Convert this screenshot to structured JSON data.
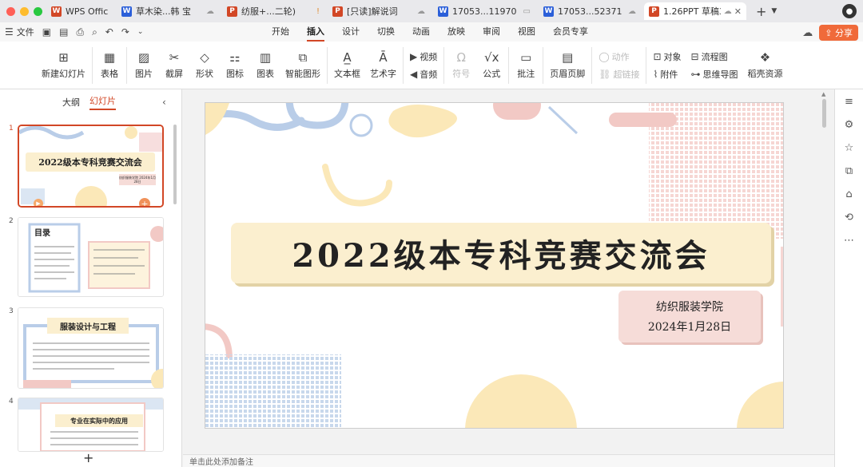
{
  "window": {
    "tabs": [
      {
        "label": "WPS Office",
        "icon": "wps-logo-icon",
        "type": "home",
        "icon_color": "#d24726",
        "state": ""
      },
      {
        "label": "草木染...韩 宝",
        "icon": "word-doc-icon",
        "icon_color": "#2b5fd9",
        "state": "☁"
      },
      {
        "label": "纺服+...二轮)",
        "icon": "ppt-doc-icon",
        "icon_color": "#d24726",
        "state": "!"
      },
      {
        "label": "[只读]解说词",
        "icon": "ppt-doc-icon",
        "icon_color": "#d24726",
        "state": "☁"
      },
      {
        "label": "17053...11970",
        "icon": "word-doc-icon",
        "icon_color": "#2b5fd9",
        "state": "▭"
      },
      {
        "label": "17053...52371",
        "icon": "word-doc-icon",
        "icon_color": "#2b5fd9",
        "state": "☁"
      },
      {
        "label": "1.26PPT 草稿3",
        "icon": "ppt-doc-icon",
        "icon_color": "#d24726",
        "state": "☁",
        "active": true
      }
    ]
  },
  "menu": {
    "file_label": "文件",
    "tabs": [
      {
        "label": "开始",
        "active": false
      },
      {
        "label": "插入",
        "active": true
      },
      {
        "label": "设计",
        "active": false
      },
      {
        "label": "切换",
        "active": false
      },
      {
        "label": "动画",
        "active": false
      },
      {
        "label": "放映",
        "active": false
      },
      {
        "label": "审阅",
        "active": false
      },
      {
        "label": "视图",
        "active": false
      },
      {
        "label": "会员专享",
        "active": false
      }
    ],
    "share_label": "分享"
  },
  "ribbon": {
    "new_slide": "新建幻灯片",
    "table": "表格",
    "picture": "图片",
    "screenshot": "截屏",
    "shape": "形状",
    "icon": "图标",
    "chart": "图表",
    "smartart": "智能图形",
    "textbox": "文本框",
    "wordart": "艺术字",
    "video": "视频",
    "audio": "音频",
    "symbol": "符号",
    "formula": "公式",
    "comment": "批注",
    "header_footer": "页眉页脚",
    "action": "动作",
    "hyperlink": "超链接",
    "object": "对象",
    "attachment": "附件",
    "flowchart": "流程图",
    "mindmap": "思维导图",
    "docer": "稻壳资源"
  },
  "left_panel": {
    "tab_outline": "大纲",
    "tab_slides": "幻灯片",
    "thumbnails": [
      {
        "num": "1",
        "title": "2022级本专科竞赛交流会",
        "sub": "纺织服装学院 2024年1月28日"
      },
      {
        "num": "2",
        "title": "目录"
      },
      {
        "num": "3",
        "title": "服装设计与工程"
      },
      {
        "num": "4",
        "title": "专业在实际中的应用"
      }
    ]
  },
  "slide": {
    "title": "2022级本专科竞赛交流会",
    "subtitle_line1": "纺织服装学院",
    "subtitle_line2": "2024年1月28日"
  },
  "notes_placeholder": "单击此处添加备注",
  "colors": {
    "accent": "#d24726",
    "title_box": "#fbefcf",
    "subtitle_box": "#f6dcd8",
    "blue_deco": "#b9cde8",
    "pink_deco": "#f2c9c5",
    "yellow_deco": "#fbe8b8"
  }
}
